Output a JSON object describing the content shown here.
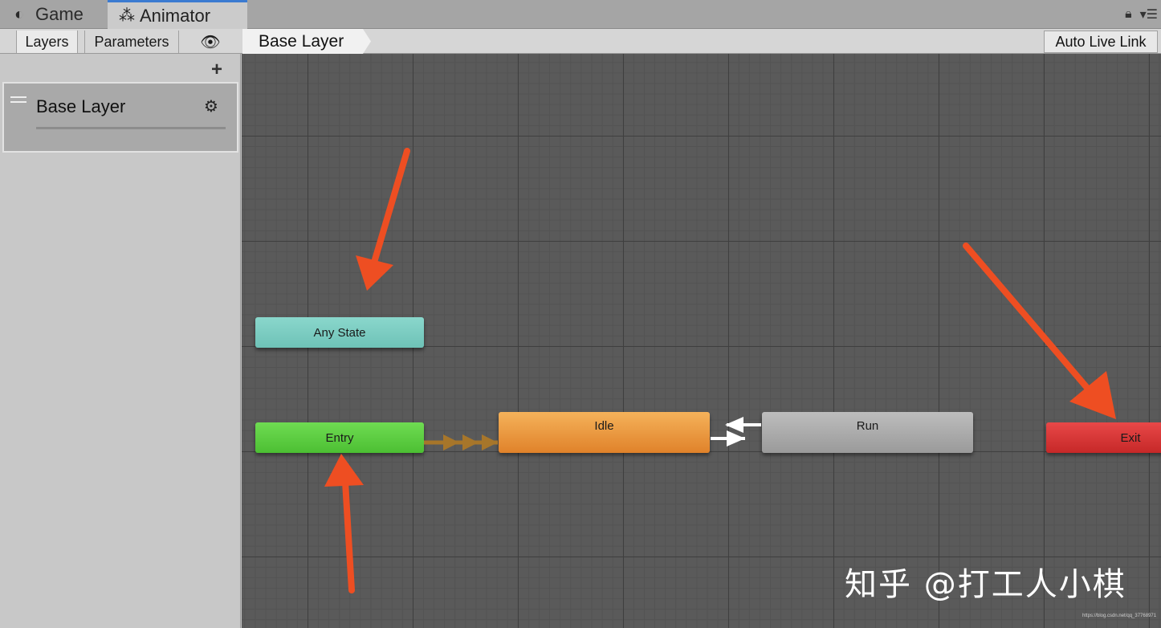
{
  "tabs": {
    "game": {
      "label": "Game",
      "icon": "pacman-icon"
    },
    "animator": {
      "label": "Animator",
      "icon": "animator-icon"
    }
  },
  "toolbar": {
    "layers_label": "Layers",
    "parameters_label": "Parameters",
    "eye_icon": "eye-icon",
    "breadcrumb": "Base Layer",
    "auto_live_link": "Auto Live Link"
  },
  "layers_panel": {
    "layers": [
      {
        "name": "Base Layer"
      }
    ]
  },
  "graph": {
    "nodes": {
      "any_state": "Any State",
      "entry": "Entry",
      "idle": "Idle",
      "run": "Run",
      "exit": "Exit"
    },
    "colors": {
      "any_state": "#6ec2b7",
      "entry": "#4cbf33",
      "idle": "#e0822a",
      "run": "#9a9a9a",
      "exit": "#c62828",
      "annotation_arrow": "#ee4e22"
    }
  },
  "watermark": "知乎 @打工人小棋",
  "source_url": "https://blog.csdn.net/qq_37768971"
}
